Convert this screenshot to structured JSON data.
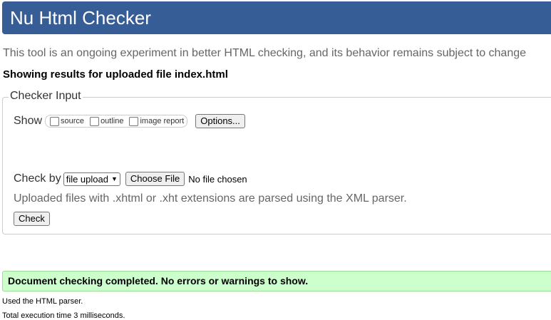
{
  "header": {
    "title": "Nu Html Checker"
  },
  "tagline": "This tool is an ongoing experiment in better HTML checking, and its behavior remains subject to change",
  "results_for": "Showing results for uploaded file index.html",
  "checker_input": {
    "legend": "Checker Input",
    "show_label": "Show",
    "show_options": [
      "source",
      "outline",
      "image report"
    ],
    "options_button": "Options...",
    "check_by_label": "Check by",
    "check_by_selected": "file upload",
    "choose_file_button": "Choose File",
    "no_file_text": "No file chosen",
    "xml_note": "Uploaded files with .xhtml or .xht extensions are parsed using the XML parser.",
    "check_button": "Check"
  },
  "results": {
    "success_message": "Document checking completed. No errors or warnings to show.",
    "parser_note": "Used the HTML parser.",
    "execution_time": "Total execution time 3 milliseconds."
  },
  "colors": {
    "header_bg": "#365d95",
    "success_bg": "#ccffcc"
  }
}
